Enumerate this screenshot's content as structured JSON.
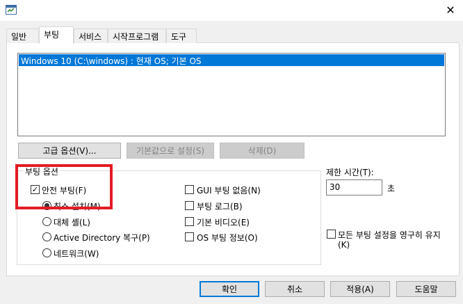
{
  "window": {
    "close_glyph": "✕"
  },
  "tabs": [
    {
      "label": "일반"
    },
    {
      "label": "부팅"
    },
    {
      "label": "서비스"
    },
    {
      "label": "시작프로그램"
    },
    {
      "label": "도구"
    }
  ],
  "os_list": {
    "entries": [
      "Windows 10 (C:\\windows) : 현재 OS; 기본 OS"
    ]
  },
  "os_buttons": {
    "advanced": "고급 옵션(V)...",
    "set_default": "기본값으로 설정(S)",
    "delete": "삭제(D)"
  },
  "boot_options": {
    "title": "부팅 옵션",
    "safe_boot": {
      "label": "안전 부팅(F)",
      "checked": true
    },
    "minimal": "최소 설치(M)",
    "alternate_shell": "대체 셸(L)",
    "ad_repair": "Active Directory 복구(P)",
    "network": "네트워크(W)",
    "no_gui_boot": "GUI 부팅 없음(N)",
    "boot_log": "부팅 로그(B)",
    "base_video": "기본 비디오(E)",
    "os_boot_info": "OS 부팅 정보(O)"
  },
  "timeout": {
    "label": "제한 시간(T):",
    "value": "30",
    "unit": "초"
  },
  "make_permanent": {
    "line1": "모든 부팅 설정을 영구히 유지",
    "line2": "(K)"
  },
  "footer": {
    "ok": "확인",
    "cancel": "취소",
    "apply": "적용(A)",
    "help": "도움말"
  }
}
